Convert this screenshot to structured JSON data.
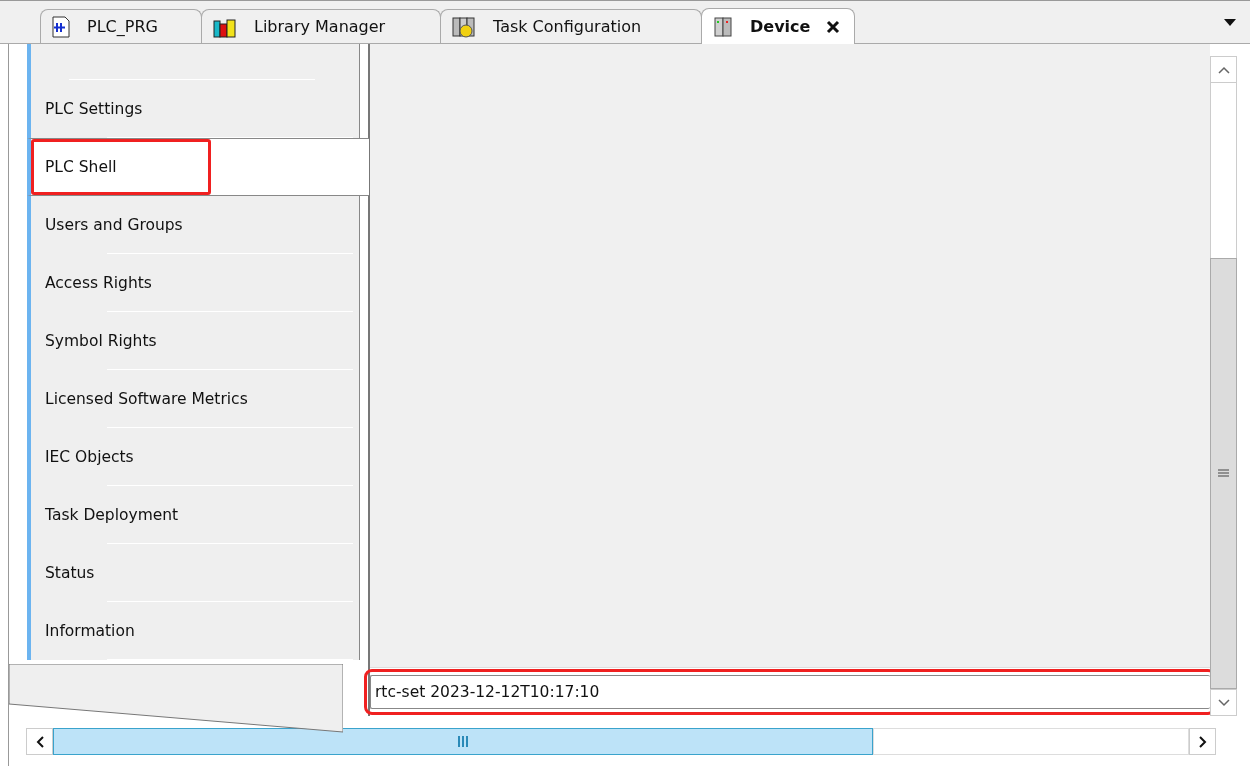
{
  "tabs": [
    {
      "label": "PLC_PRG",
      "kind": "program",
      "selected": false,
      "closable": false
    },
    {
      "label": "Library Manager",
      "kind": "library",
      "selected": false,
      "closable": false
    },
    {
      "label": "Task Configuration",
      "kind": "tasks",
      "selected": false,
      "closable": false
    },
    {
      "label": "Device",
      "kind": "device",
      "selected": true,
      "closable": true
    }
  ],
  "sidebar": {
    "items": [
      {
        "label": "PLC Settings",
        "selected": false,
        "highlighted": false
      },
      {
        "label": "PLC Shell",
        "selected": true,
        "highlighted": true
      },
      {
        "label": "Users and Groups",
        "selected": false,
        "highlighted": false
      },
      {
        "label": "Access Rights",
        "selected": false,
        "highlighted": false
      },
      {
        "label": "Symbol Rights",
        "selected": false,
        "highlighted": false
      },
      {
        "label": "Licensed Software Metrics",
        "selected": false,
        "highlighted": false
      },
      {
        "label": "IEC Objects",
        "selected": false,
        "highlighted": false
      },
      {
        "label": "Task Deployment",
        "selected": false,
        "highlighted": false
      },
      {
        "label": "Status",
        "selected": false,
        "highlighted": false
      },
      {
        "label": "Information",
        "selected": false,
        "highlighted": false
      }
    ]
  },
  "shell": {
    "command": {
      "value": "rtc-set 2023-12-12T10:17:10",
      "highlighted": true
    }
  }
}
